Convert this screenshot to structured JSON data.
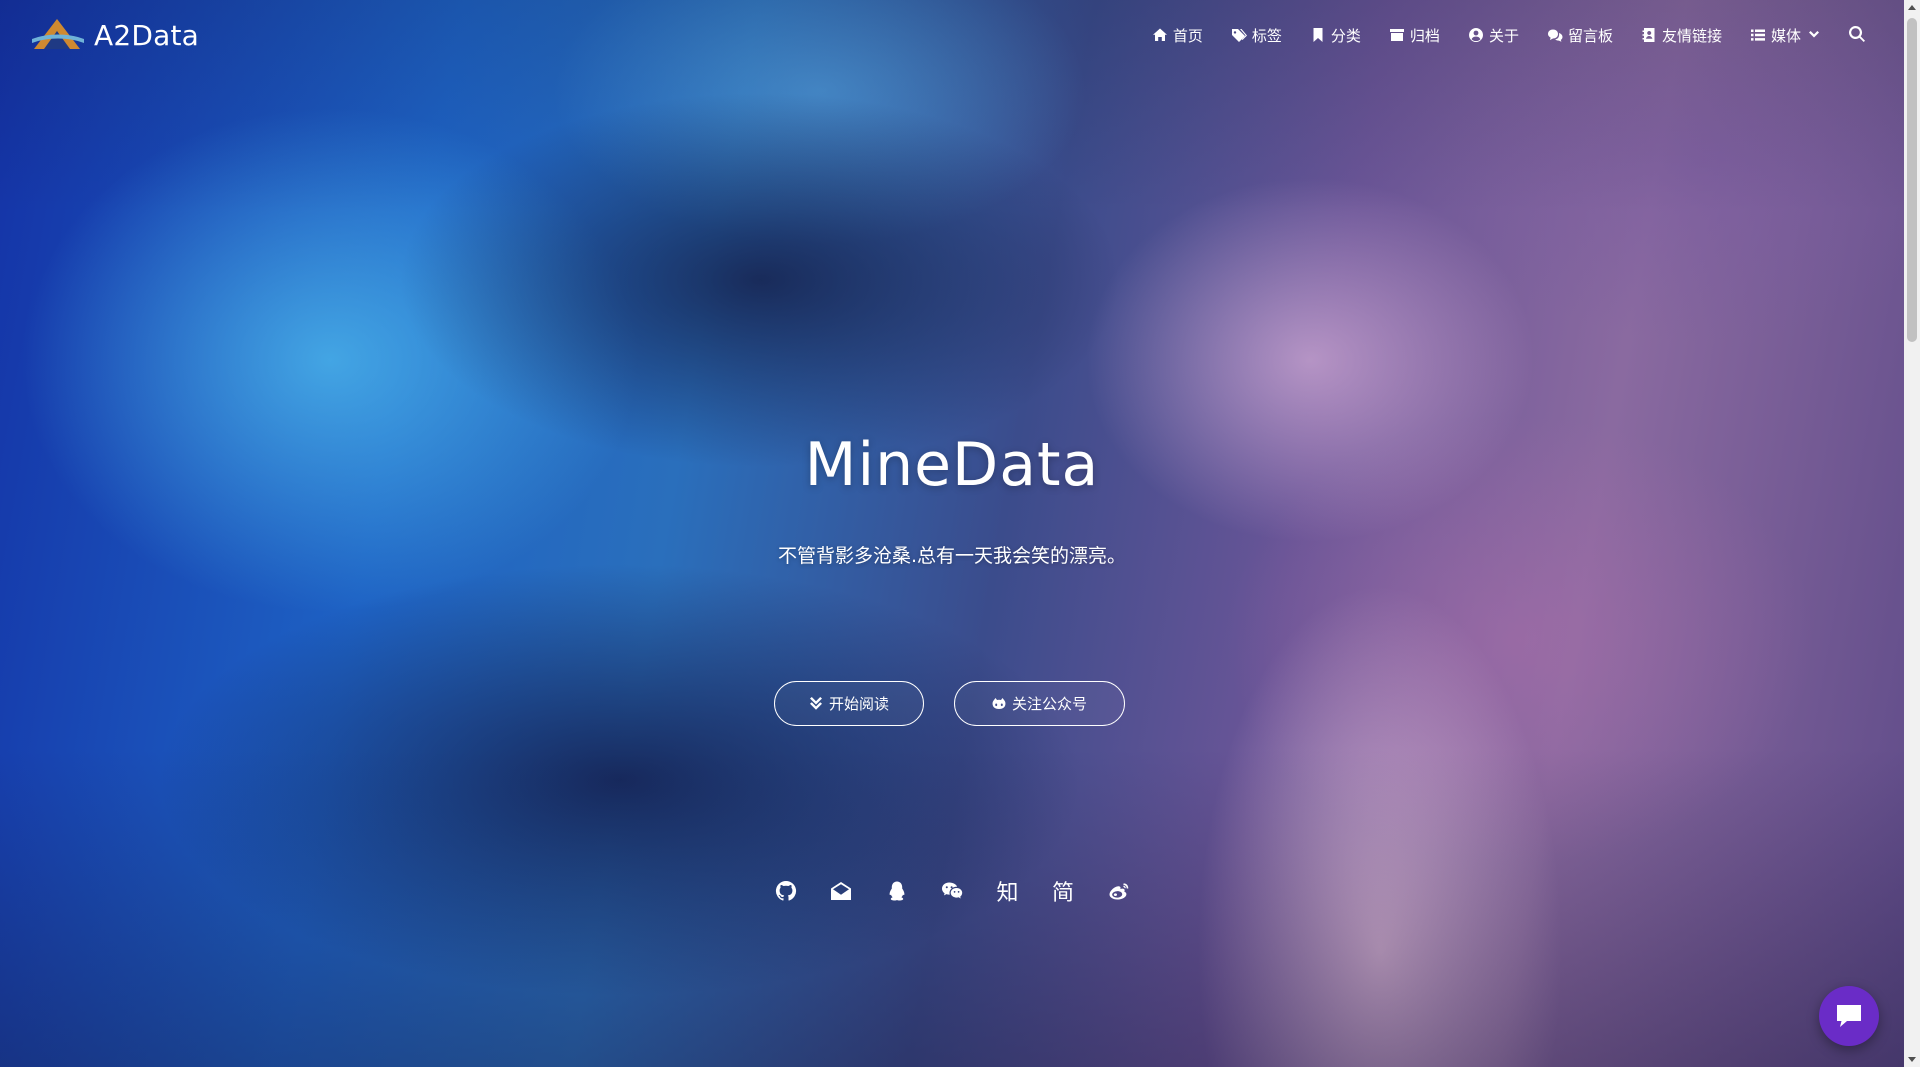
{
  "brand": {
    "name": "A2Data",
    "logo_icon": "a2data-logo-icon"
  },
  "nav": {
    "items": [
      {
        "label": "首页",
        "icon": "home-icon"
      },
      {
        "label": "标签",
        "icon": "tags-icon"
      },
      {
        "label": "分类",
        "icon": "bookmark-icon"
      },
      {
        "label": "归档",
        "icon": "archive-icon"
      },
      {
        "label": "关于",
        "icon": "user-circle-icon"
      },
      {
        "label": "留言板",
        "icon": "comments-icon"
      },
      {
        "label": "友情链接",
        "icon": "address-book-icon"
      },
      {
        "label": "媒体",
        "icon": "list-icon",
        "has_dropdown": true
      }
    ],
    "search_icon": "search-icon"
  },
  "hero": {
    "title": "MineData",
    "subtitle": "不管背影多沧桑.总有一天我会笑的漂亮。",
    "read_button": "开始阅读",
    "follow_button": "关注公众号"
  },
  "socials": [
    {
      "name": "github",
      "icon": "github-icon"
    },
    {
      "name": "email",
      "icon": "envelope-open-icon"
    },
    {
      "name": "qq",
      "icon": "qq-icon"
    },
    {
      "name": "wechat",
      "icon": "wechat-icon"
    },
    {
      "name": "zhihu",
      "text": "知"
    },
    {
      "name": "jianshu",
      "text": "简"
    },
    {
      "name": "weibo",
      "icon": "weibo-icon"
    }
  ],
  "colors": {
    "chat_bubble": "#6a2cc7",
    "text": "#ffffff"
  },
  "chat_icon": "chat-bubble-icon"
}
